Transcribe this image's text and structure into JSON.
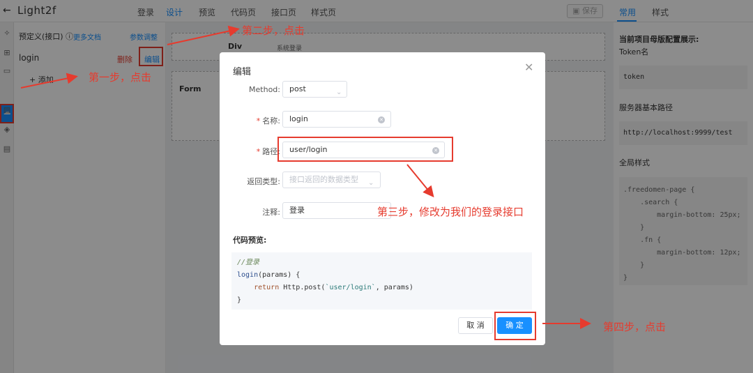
{
  "topbar": {
    "back_icon": "back-arrow-icon",
    "title": "Light2f",
    "tabs": [
      "登录",
      "设计",
      "预览",
      "代码页",
      "接口页",
      "样式页"
    ],
    "active_tab": "设计",
    "save_label": "保存",
    "right_tabs": [
      "常用",
      "样式"
    ],
    "active_right_tab": "常用"
  },
  "rail": {
    "icons": [
      "puzzle-icon",
      "grid-icon",
      "window-icon",
      "cloud-icon",
      "image-icon",
      "cube-icon",
      "calendar-icon"
    ]
  },
  "left_panel": {
    "title": "预定义(接口)",
    "help_icon": "question-icon",
    "more_docs": "更多文档",
    "param_adjust": "参数调整",
    "item_name": "login",
    "delete_label": "删除",
    "edit_label": "编辑",
    "add_label": "+ 添加"
  },
  "canvas": {
    "div_label": "Div",
    "form_label": "Form",
    "small_text": "系统登录"
  },
  "right_panel": {
    "section_title": "当前项目母版配置展示:",
    "token_label": "Token名",
    "token_value": "token",
    "base_path_label": "服务器基本路径",
    "base_path_value": "http://localhost:9999/test",
    "global_style_label": "全局样式",
    "css": ".freedomen-page {\n    .search {\n        margin-bottom: 25px;\n    }\n    .fn {\n        margin-bottom: 12px;\n    }\n}"
  },
  "modal": {
    "title": "编辑",
    "close_icon": "close-icon",
    "method_label": "Method:",
    "method_value": "post",
    "name_label": "名称:",
    "name_value": "login",
    "path_label": "路径:",
    "path_value": "user/login",
    "return_type_label": "返回类型:",
    "return_type_placeholder": "接口返回的数据类型",
    "note_label": "注释:",
    "note_value": "登录",
    "code_preview_label": "代码预览:",
    "code": {
      "comment": "//登录",
      "line1_fn": "login",
      "line1_rest": "(params) {",
      "line2_kw": "return",
      "line2_mid": " Http.post(",
      "line2_str": "`user/login`",
      "line2_end": ", params)",
      "line3": "}"
    },
    "cancel_label": "取 消",
    "confirm_label": "确 定"
  },
  "annotations": {
    "step1": "第一步，点击",
    "step2": "第二步，点击",
    "step3": "第三步，修改为我们的登录接口",
    "step4": "第四步，点击"
  },
  "colors": {
    "accent": "#1890ff",
    "annotation": "#e63b2e"
  }
}
